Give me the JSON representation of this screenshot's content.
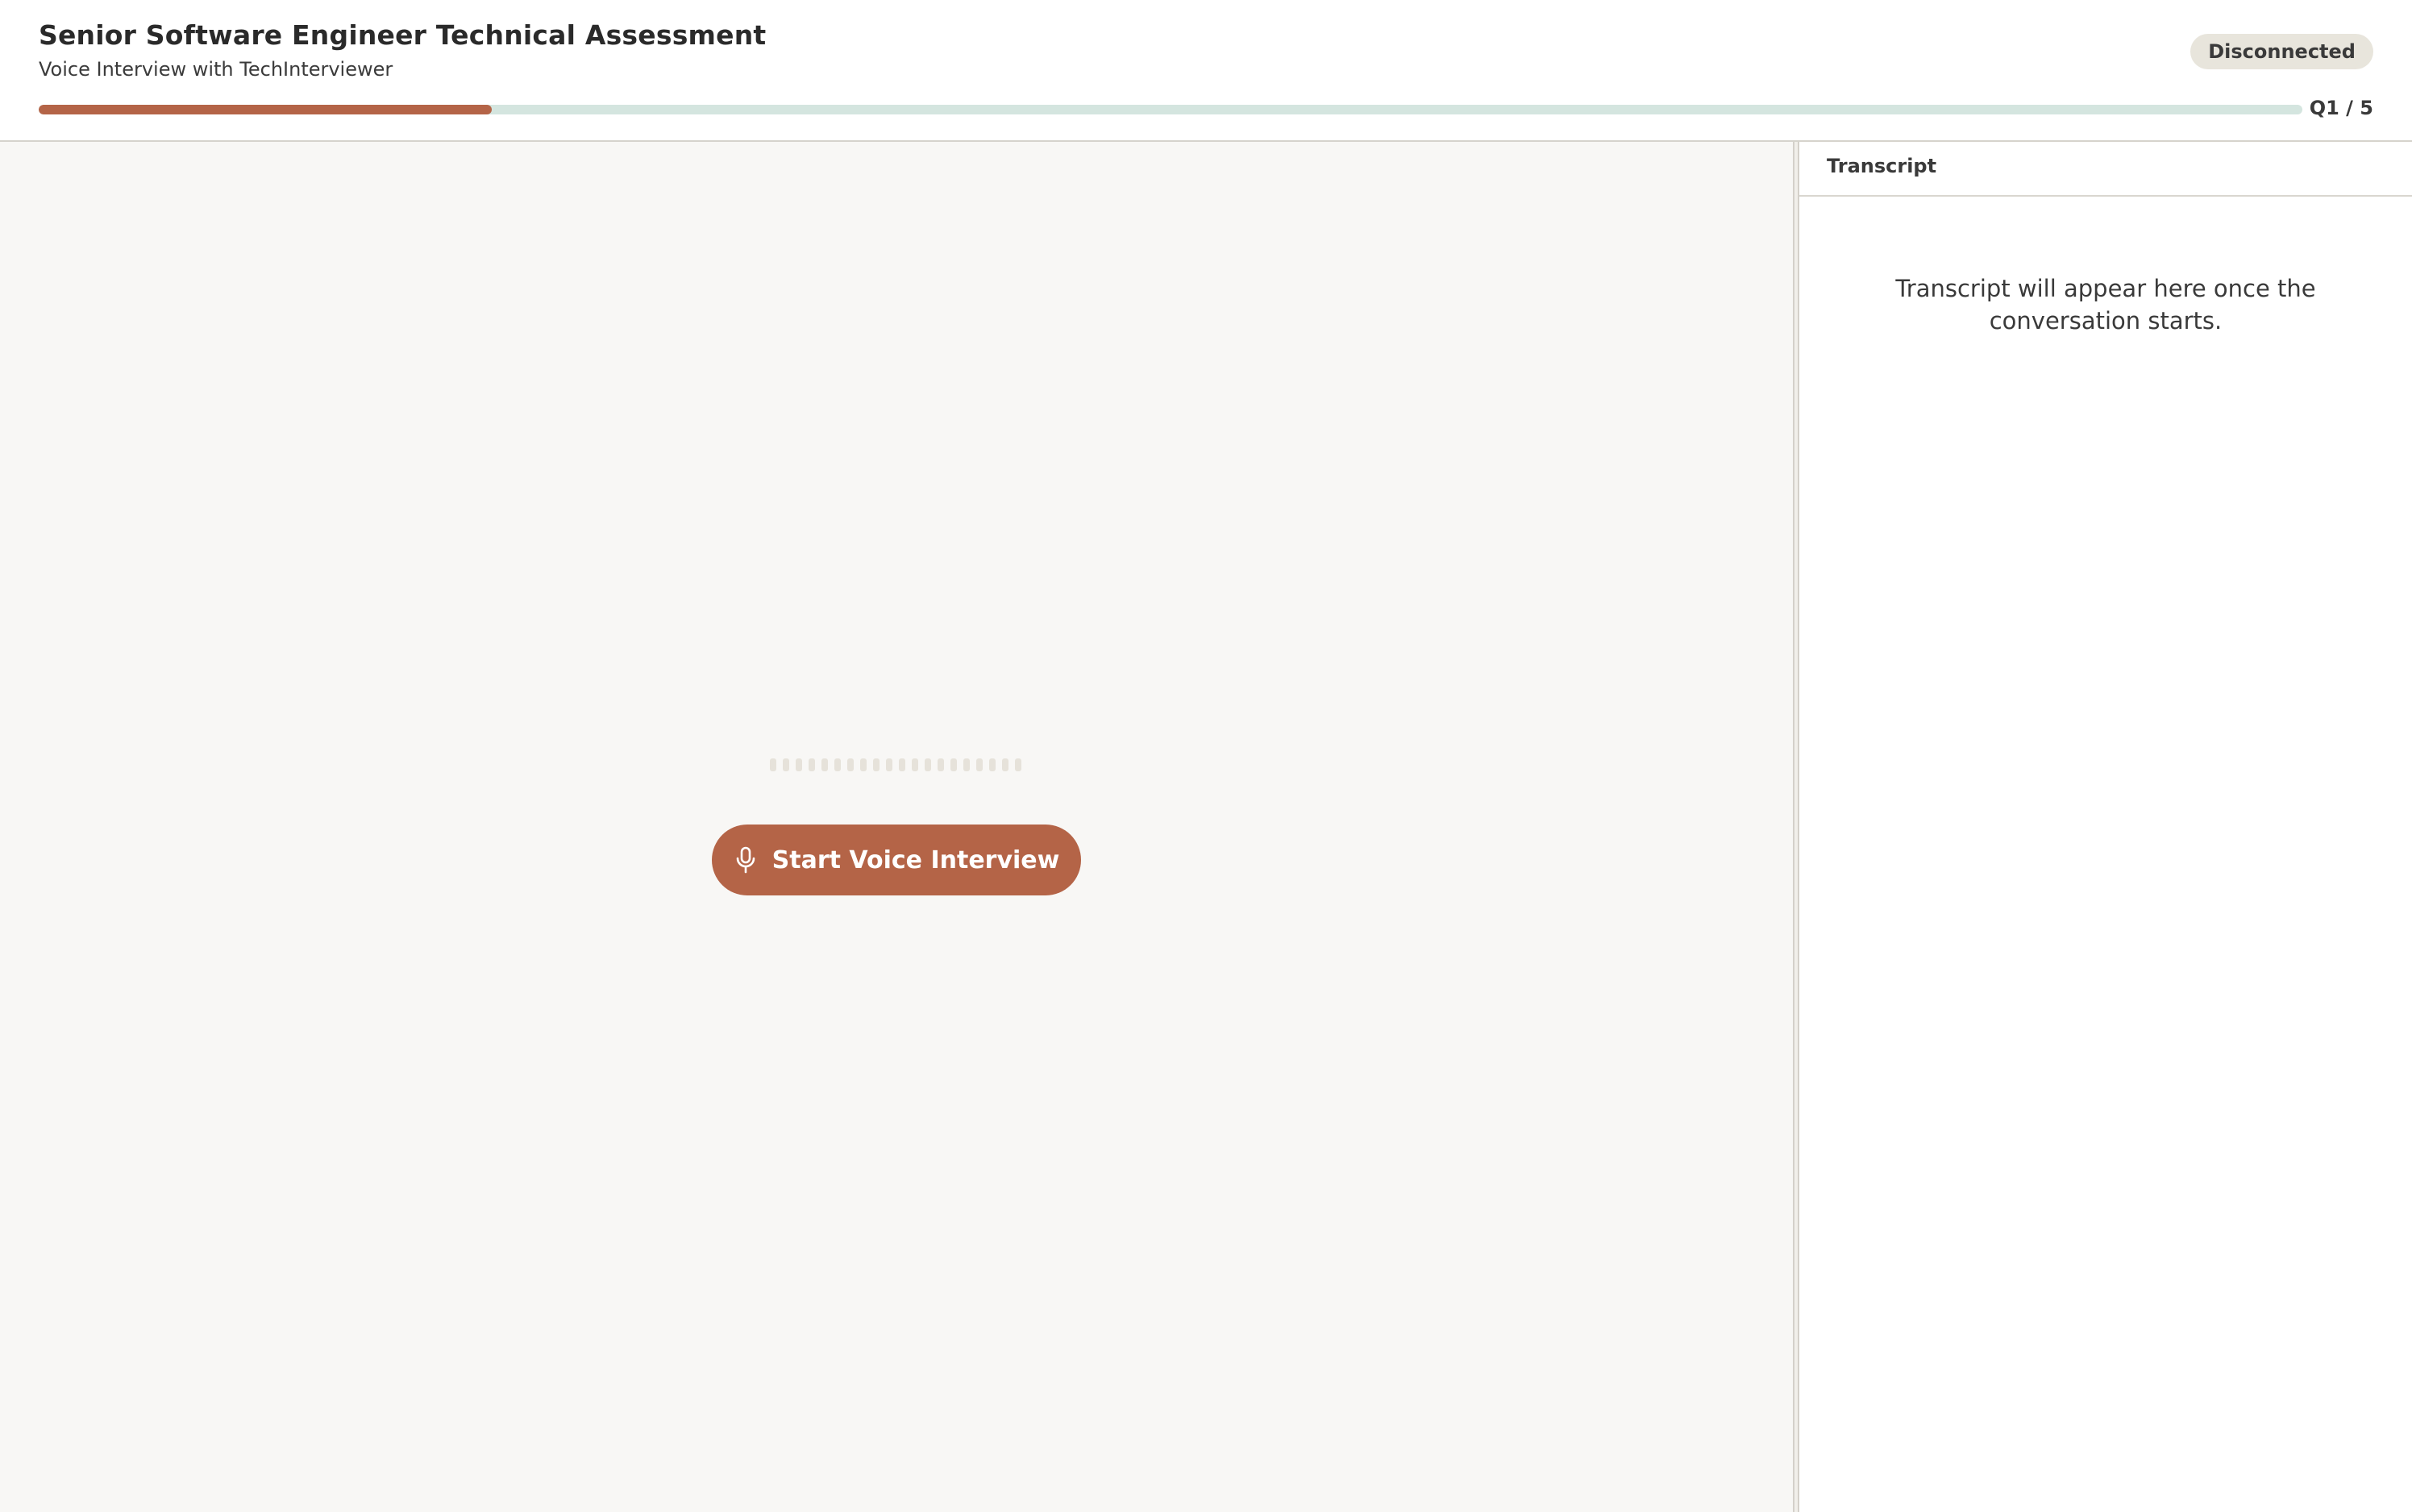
{
  "header": {
    "title": "Senior Software Engineer Technical Assessment",
    "subtitle": "Voice Interview with TechInterviewer",
    "status": "Disconnected",
    "progress": {
      "fraction": 0.2,
      "label": "Q1 / 5"
    }
  },
  "stage": {
    "waveform_bars": 20,
    "start_button": {
      "label": "Start Voice Interview",
      "icon": "microphone-icon"
    }
  },
  "transcript": {
    "title": "Transcript",
    "empty_message": "Transcript will appear here once the conversation starts."
  },
  "colors": {
    "accent": "#b46447",
    "progress_track": "#d4e5df",
    "stage_background": "#f8f7f5",
    "badge_background": "#e8e5dc"
  }
}
